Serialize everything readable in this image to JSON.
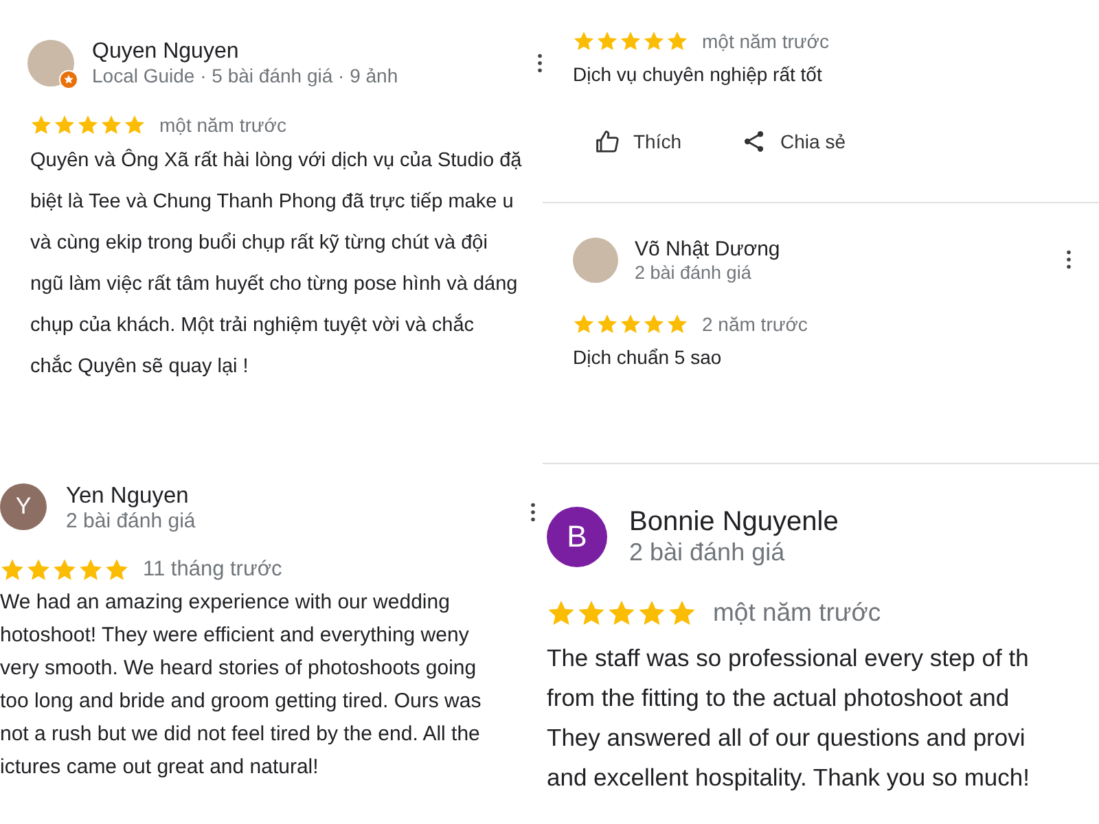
{
  "columns": [
    {
      "reviews": [
        {
          "name": "Quyen Nguyen",
          "meta": "Local Guide · 5 bài đánh giá · 9 ảnh",
          "avatar": {
            "kind": "photo",
            "local_guide": true
          },
          "menu_button": true,
          "stars": 5,
          "time": "một năm trước",
          "body": [
            "Quyên và Ông Xã rất hài lòng với dịch vụ của Studio đặ",
            "biệt là Tee và Chung Thanh Phong đã trực tiếp make u",
            "và cùng ekip trong buổi chụp rất kỹ từng chút và đội",
            "ngũ làm việc rất tâm huyết cho từng pose hình và dáng",
            "chụp của khách. Một trải nghiệm tuyệt vời và chắc",
            "chắc Quyên sẽ quay lại !"
          ]
        },
        {
          "name": "Yen Nguyen",
          "meta": "2 bài đánh giá",
          "avatar": {
            "kind": "letter",
            "letter": "Y",
            "color": "#8d6e63"
          },
          "menu_button": true,
          "stars": 5,
          "time": "11 tháng trước",
          "body": [
            "We had an amazing experience with our wedding",
            "hotoshoot! They were efficient and everything weny",
            "very smooth. We heard stories of photoshoots going",
            "too long and bride and groom getting tired. Ours was",
            "not a rush but we did not feel tired by the end. All the",
            "ictures came out great and natural!"
          ]
        }
      ]
    },
    {
      "reviews": [
        {
          "stars": 5,
          "time": "một năm trước",
          "menu_button": false,
          "body": [
            "Dịch vụ chuyên nghiệp rất tốt"
          ],
          "actions": [
            {
              "kind": "like",
              "label": "Thích"
            },
            {
              "kind": "share",
              "label": "Chia sẻ"
            }
          ]
        },
        {
          "name": "Võ Nhật Dương",
          "meta": "2 bài đánh giá",
          "avatar": {
            "kind": "photo",
            "local_guide": false
          },
          "menu_button": true,
          "stars": 5,
          "time": "2 năm trước",
          "body": [
            "Dịch chuẩn 5 sao"
          ]
        },
        {
          "name": "Bonnie Nguyenle",
          "meta": "2 bài đánh giá",
          "avatar": {
            "kind": "letter",
            "letter": "B",
            "color": "#7b1fa2"
          },
          "menu_button": false,
          "stars": 5,
          "time": "một năm trước",
          "body": [
            "The staff was so professional every step of th",
            "from the fitting to the actual photoshoot and",
            "They answered all of our questions and provi",
            "and excellent hospitality. Thank you so much!"
          ]
        }
      ]
    }
  ]
}
